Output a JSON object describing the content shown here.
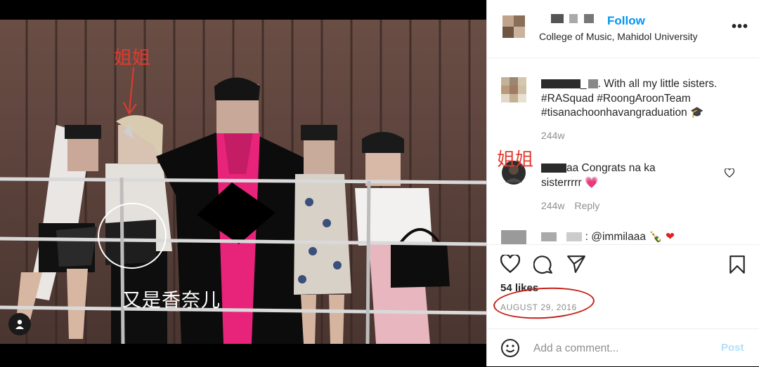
{
  "photo": {
    "annotation_top": "姐姐",
    "annotation_bottom": "又是香奈儿"
  },
  "header": {
    "follow_label": "Follow",
    "location": "College of Music, Mahidol University"
  },
  "caption": {
    "user_suffix": "_",
    "line1": ". With all my little sisters.",
    "line2": "#RASquad #RoongAroonTeam",
    "line3": "#tisanachoonhavangraduation 🎓",
    "time": "244w"
  },
  "comment1": {
    "annotation": "姐姐",
    "user_suffix": "aa",
    "line1": " Congrats na ka",
    "line2": "sisterrrrr 💗",
    "time": "244w",
    "reply_label": "Reply"
  },
  "comment2": {
    "partial_text": ": @immilaaa"
  },
  "post": {
    "likes": "54 likes",
    "date": "AUGUST 29, 2016"
  },
  "add_comment": {
    "placeholder": "Add a comment...",
    "post_label": "Post"
  },
  "icons": {
    "heart": "heart-icon",
    "comment": "comment-icon",
    "share": "share-icon",
    "bookmark": "bookmark-icon",
    "emoji": "emoji-icon",
    "more": "more-icon",
    "user_tag": "user-tag-icon"
  },
  "colors": {
    "follow_blue": "#0095f6",
    "annotation_red": "#e23a2e",
    "gown_pink": "#e8237a",
    "post_disabled": "#b2dffc"
  }
}
